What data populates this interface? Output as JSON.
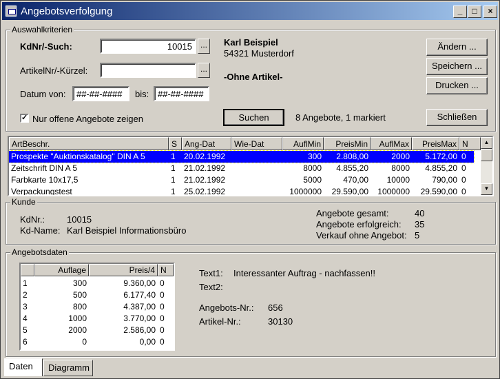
{
  "window": {
    "title": "Angebotsverfolgung",
    "controls": {
      "minimize": "_",
      "maximize": "□",
      "close": "×"
    }
  },
  "selection": {
    "group_label": "Auswahlkriterien",
    "kdnr_label": "KdNr/-Such:",
    "kdnr_value": "10015",
    "artikel_label": "ArtikelNr/-Kürzel:",
    "artikel_value": "",
    "datum_von_label": "Datum von:",
    "datum_von_value": "##-##-####",
    "bis_label": "bis:",
    "bis_value": "##-##-####",
    "checkbox_label": "Nur offene Angebote zeigen",
    "checkbox_checked": true,
    "lookup_dots": "...",
    "customer_name": "Karl Beispiel",
    "customer_city": "54321 Musterdorf",
    "article_info": "-Ohne Artikel-",
    "search_button": "Suchen",
    "status_text": "8 Angebote, 1 markiert",
    "buttons": {
      "aendern": "Ändern ...",
      "speichern": "Speichern ...",
      "drucken": "Drucken ...",
      "schliessen": "Schließen"
    }
  },
  "offers_table": {
    "columns": [
      "ArtBeschr.",
      "S",
      "Ang-Dat",
      "Wie-Dat",
      "AuflMin",
      "PreisMin",
      "AuflMax",
      "PreisMax",
      "N"
    ],
    "rows": [
      [
        "Prospekte \"Auktionskatalog\" DIN A 5",
        "1",
        "20.02.1992",
        "",
        "300",
        "2.808,00",
        "2000",
        "5.172,00",
        "0"
      ],
      [
        "Zeitschrift DIN A 5",
        "1",
        "21.02.1992",
        "",
        "8000",
        "4.855,20",
        "8000",
        "4.855,20",
        "0"
      ],
      [
        "Farbkarte 10x17,5",
        "1",
        "21.02.1992",
        "",
        "5000",
        "470,00",
        "10000",
        "790,00",
        "0"
      ],
      [
        "Verpackungstest",
        "1",
        "25.02.1992",
        "",
        "1000000",
        "29.590,00",
        "1000000",
        "29.590,00",
        "0"
      ]
    ],
    "selected_row": 0
  },
  "customer": {
    "group_label": "Kunde",
    "kdnr_label": "KdNr.:",
    "kdnr_value": "10015",
    "kdname_label": "Kd-Name:",
    "kdname_value": "Karl Beispiel Informationsbüro",
    "stats": [
      {
        "label": "Angebote gesamt:",
        "value": "40"
      },
      {
        "label": "Angebote erfolgreich:",
        "value": "35"
      },
      {
        "label": "Verkauf ohne Angebot:",
        "value": "5"
      }
    ]
  },
  "offer_data": {
    "group_label": "Angebotsdaten",
    "grid_columns": [
      "",
      "Auflage",
      "Preis/4",
      "N"
    ],
    "grid_rows": [
      [
        "1",
        "300",
        "9.360,00",
        "0"
      ],
      [
        "2",
        "500",
        "6.177,40",
        "0"
      ],
      [
        "3",
        "800",
        "4.387,00",
        "0"
      ],
      [
        "4",
        "1000",
        "3.770,00",
        "0"
      ],
      [
        "5",
        "2000",
        "2.586,00",
        "0"
      ],
      [
        "6",
        "0",
        "0,00",
        "0"
      ]
    ],
    "text1_label": "Text1:",
    "text1_value": "Interessanter Auftrag - nachfassen!!",
    "text2_label": "Text2:",
    "text2_value": "",
    "angebotsnr_label": "Angebots-Nr.:",
    "angebotsnr_value": "656",
    "artikelnr_label": "Artikel-Nr.:",
    "artikelnr_value": "30130"
  },
  "tabs": [
    {
      "label": "Daten",
      "active": true
    },
    {
      "label": "Diagramm",
      "active": false
    }
  ]
}
